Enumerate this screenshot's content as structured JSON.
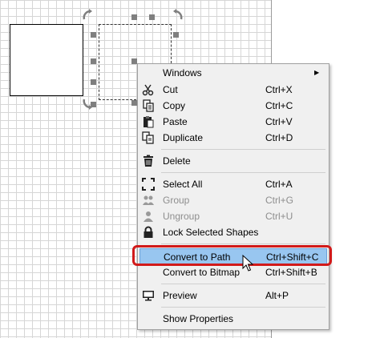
{
  "menu": {
    "windows": {
      "label": "Windows"
    },
    "cut": {
      "label": "Cut",
      "shortcut": "Ctrl+X"
    },
    "copy": {
      "label": "Copy",
      "shortcut": "Ctrl+C"
    },
    "paste": {
      "label": "Paste",
      "shortcut": "Ctrl+V"
    },
    "duplicate": {
      "label": "Duplicate",
      "shortcut": "Ctrl+D"
    },
    "delete": {
      "label": "Delete"
    },
    "select_all": {
      "label": "Select All",
      "shortcut": "Ctrl+A"
    },
    "group": {
      "label": "Group",
      "shortcut": "Ctrl+G"
    },
    "ungroup": {
      "label": "Ungroup",
      "shortcut": "Ctrl+U"
    },
    "lock": {
      "label": "Lock Selected Shapes"
    },
    "convert_path": {
      "label": "Convert to Path",
      "shortcut": "Ctrl+Shift+C"
    },
    "convert_bitmap": {
      "label": "Convert to Bitmap",
      "shortcut": "Ctrl+Shift+B"
    },
    "preview": {
      "label": "Preview",
      "shortcut": "Alt+P"
    },
    "properties": {
      "label": "Show Properties"
    }
  },
  "colors": {
    "highlight": "#98c6f0",
    "annotation": "#d11a1a",
    "grid": "#d6d6d6"
  },
  "icons": [
    "scissors-icon",
    "copy-icon",
    "paste-icon",
    "duplicate-icon",
    "trash-icon",
    "select-all-icon",
    "group-icon",
    "ungroup-icon",
    "lock-icon",
    "monitor-icon",
    "rotate-handle-icon",
    "cursor-icon"
  ]
}
